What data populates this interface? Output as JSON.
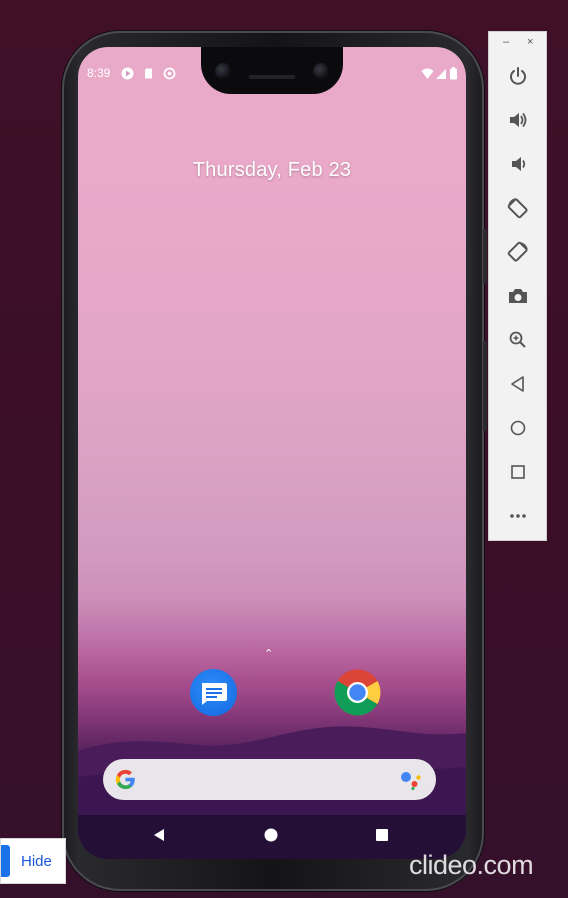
{
  "status_bar": {
    "time": "8:39"
  },
  "home": {
    "date": "Thursday, Feb 23",
    "dock_apps": [
      {
        "name": "Messages"
      },
      {
        "name": "Chrome"
      }
    ],
    "search_bar": {
      "logo": "G"
    }
  },
  "toolbar": {
    "minimize": "–",
    "close": "×",
    "buttons": [
      "power",
      "volume-up",
      "volume-down",
      "rotate-left",
      "rotate-right",
      "screenshot",
      "zoom",
      "back",
      "home",
      "overview",
      "more"
    ]
  },
  "hide_button": {
    "label": "Hide"
  },
  "watermark": "clideo.com",
  "colors": {
    "accent": "#1a73e8",
    "background": "#3e0f2a"
  }
}
